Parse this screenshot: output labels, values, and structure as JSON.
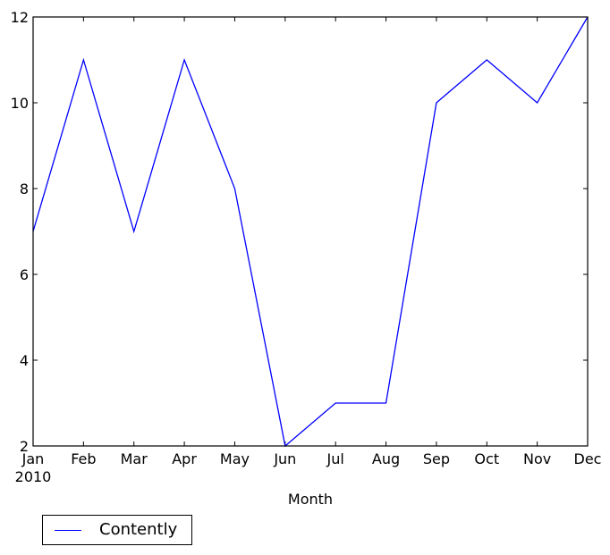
{
  "chart_data": {
    "type": "line",
    "title": "",
    "xlabel": "Month",
    "ylabel": "",
    "categories": [
      "Jan",
      "Feb",
      "Mar",
      "Apr",
      "May",
      "Jun",
      "Jul",
      "Aug",
      "Sep",
      "Oct",
      "Nov",
      "Dec"
    ],
    "x_tick_sublabel": "2010",
    "series": [
      {
        "name": "Contently",
        "color": "#0000ff",
        "values": [
          7,
          11,
          7,
          11,
          8,
          2,
          3,
          3,
          10,
          11,
          10,
          12
        ]
      }
    ],
    "ylim": [
      2,
      12
    ],
    "yticks": [
      2,
      4,
      6,
      8,
      10,
      12
    ],
    "grid": false,
    "legend": {
      "placement": "bottom-left-outside",
      "entries": [
        "Contently"
      ]
    }
  }
}
